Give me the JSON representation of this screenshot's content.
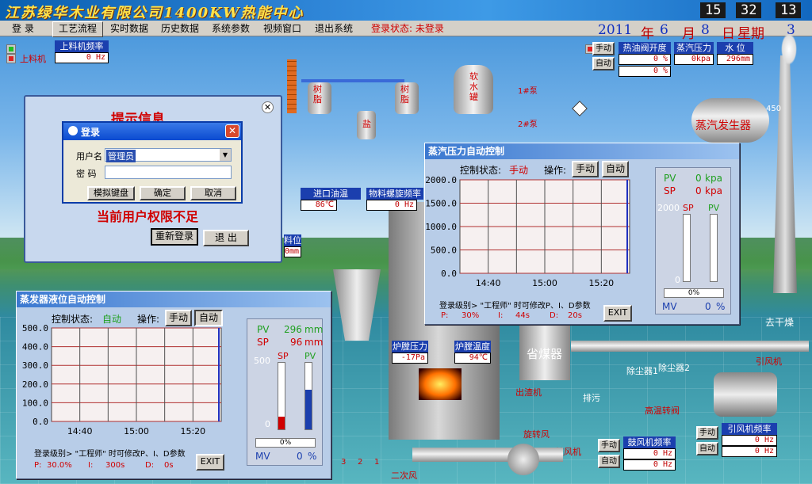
{
  "header": {
    "title": "江苏绿华木业有限公司1400KW热能中心",
    "clock": {
      "h": "15",
      "m": "32",
      "s": "13"
    }
  },
  "menu": [
    "登  录",
    "工艺流程",
    "实时数据",
    "历史数据",
    "系统参数",
    "视频窗口",
    "退出系统"
  ],
  "login_state": "登录状态:  未登录",
  "date": {
    "year": "2011",
    "y": "年",
    "month": "6",
    "mo": "月",
    "day": "8",
    "d": "日",
    "week": "星期",
    "wd": "3"
  },
  "top": {
    "feeder_freq_label": "上料机频率",
    "feeder_freq_value": "0 Hz",
    "feeder_label": "上料机",
    "manual": "手动",
    "auto": "自动",
    "oil_valve_label": "热油阀开度",
    "oil_valve_value": "0 %",
    "oil_valve_value2": "0 %",
    "steam_press_label": "蒸汽压力",
    "steam_press_value": "0kpa",
    "water_level_label": "水 位",
    "water_level_value": "296mm",
    "resin1": "树脂",
    "resin2": "树脂",
    "salt": "盐",
    "soft_tank": "软水罐",
    "pump1": "1#泵",
    "pump2": "2#泵",
    "steam_gen": "蒸汽发生器",
    "scale_450": "450"
  },
  "mid": {
    "inlet_oil_temp_label": "进口油温",
    "inlet_oil_temp_value": "86℃",
    "screw_freq_label": "物料螺旋频率",
    "screw_freq_value": "0 Hz",
    "material_level_label": "料位",
    "material_level_value": "0mm",
    "furnace_press_label": "炉膛压力",
    "furnace_press_value": "-17Pa",
    "furnace_temp_label": "炉膛温度",
    "furnace_temp_value": "94℃",
    "economizer": "省煤器",
    "dust1": "除尘器1",
    "dust2": "除尘器2",
    "high_temp_fan": "高温转阀",
    "drain": "排污",
    "ash": "出渣机",
    "blower": "鼓风机",
    "secondary": "二次风",
    "rotary": "旋转风",
    "induced_label": "引风机",
    "to_dry": "去干燥",
    "tertiary": [
      "3",
      "2",
      "1"
    ]
  },
  "bottom": {
    "blower_freq_label": "鼓风机频率",
    "blower_freq_value1": "0 Hz",
    "blower_freq_value2": "0 Hz",
    "induced_freq_label": "引风机频率",
    "induced_freq_value1": "0 Hz",
    "induced_freq_value2": "0 Hz",
    "manual": "手动",
    "auto": "自动"
  },
  "dialog": {
    "title": "提示信息",
    "login_title": "登录",
    "user_label": "用户名",
    "user_value": "管理员",
    "pwd_label": "密  码",
    "kbd": "模拟键盘",
    "ok": "确定",
    "cancel": "取消",
    "warning": "当前用户权限不足",
    "relogin": "重新登录",
    "exit": "退  出"
  },
  "steam_ctrl": {
    "title": "蒸汽压力自动控制",
    "state_label": "控制状态:",
    "state": "手动",
    "op_label": "操作:",
    "manual": "手动",
    "auto": "自动",
    "y_ticks": [
      "2000.0",
      "1500.0",
      "1000.0",
      "500.0",
      "0.0"
    ],
    "x_ticks": [
      "14:40",
      "15:00",
      "15:20"
    ],
    "pv_label": "PV",
    "pv_value": "0",
    "pv_unit": "kpa",
    "sp_label": "SP",
    "sp_value": "0",
    "sp_unit": "kpa",
    "bar_top": "2000",
    "bar_sp": "SP",
    "bar_pv": "PV",
    "bar_zero": "0",
    "mv_pct": "0%",
    "mv_label": "MV",
    "mv_value": "0",
    "mv_unit": "%",
    "note": "登录级别> \"工程师\" 时可修改P、I、D参数",
    "p_label": "P:",
    "p": "30%",
    "i_label": "I:",
    "i": "44s",
    "d_label": "D:",
    "d": "20s",
    "exit": "EXIT"
  },
  "level_ctrl": {
    "title": "蒸发器液位自动控制",
    "state_label": "控制状态:",
    "state": "自动",
    "op_label": "操作:",
    "manual": "手动",
    "auto": "自动",
    "y_ticks": [
      "500.0",
      "400.0",
      "300.0",
      "200.0",
      "100.0",
      "0.0"
    ],
    "x_ticks": [
      "14:40",
      "15:00",
      "15:20"
    ],
    "pv_label": "PV",
    "pv_value": "296",
    "pv_unit": "mm",
    "sp_label": "SP",
    "sp_value": "96",
    "sp_unit": "mm",
    "bar_top": "500",
    "bar_sp": "SP",
    "bar_pv": "PV",
    "bar_zero": "0",
    "mv_pct": "0%",
    "mv_label": "MV",
    "mv_value": "0",
    "mv_unit": "%",
    "note": "登录级别> \"工程师\" 时可修改P、I、D参数",
    "p_label": "P:",
    "p": "30.0%",
    "i_label": "I:",
    "i": "300s",
    "d_label": "D:",
    "d": "0s",
    "exit": "EXIT",
    "sp_level": 0.192,
    "pv_level": 0.592
  },
  "colors": {
    "accent": "#1b3fae",
    "alarm": "#d00000",
    "pv": "#20a020"
  }
}
